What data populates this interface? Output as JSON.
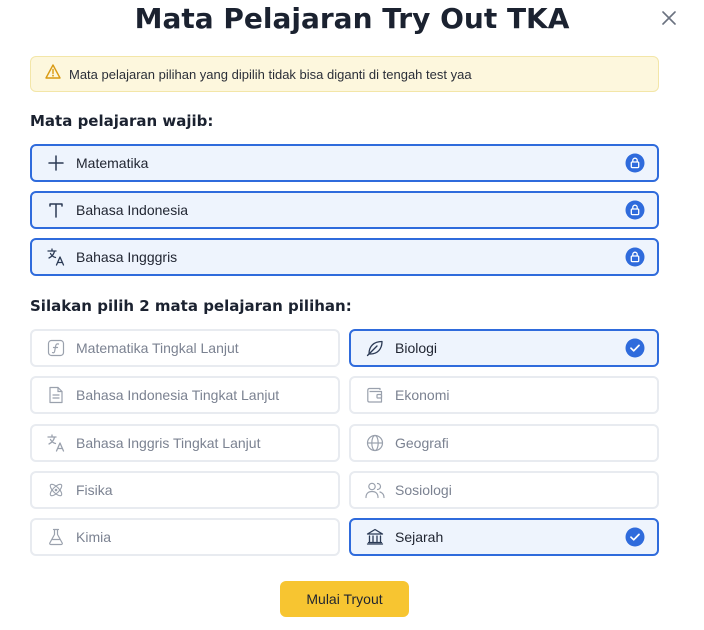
{
  "modal": {
    "title": "Mata Pelajaran Try Out TKA",
    "warning": "Mata pelajaran pilihan yang dipilih tidak bisa diganti di tengah test yaa"
  },
  "mandatory": {
    "label": "Mata pelajaran wajib:",
    "items": [
      {
        "label": "Matematika",
        "icon": "plus-icon"
      },
      {
        "label": "Bahasa Indonesia",
        "icon": "text-t-icon"
      },
      {
        "label": "Bahasa Ingggris",
        "icon": "translate-icon"
      }
    ]
  },
  "optional": {
    "label": "Silakan pilih 2 mata pelajaran pilihan:",
    "items": [
      {
        "label": "Matematika Tingkal Lanjut",
        "icon": "function-icon",
        "selected": false
      },
      {
        "label": "Biologi",
        "icon": "leaf-icon",
        "selected": true
      },
      {
        "label": "Bahasa Indonesia Tingkat Lanjut",
        "icon": "document-icon",
        "selected": false
      },
      {
        "label": "Ekonomi",
        "icon": "wallet-icon",
        "selected": false
      },
      {
        "label": "Bahasa Inggris Tingkat Lanjut",
        "icon": "translate-icon",
        "selected": false
      },
      {
        "label": "Geografi",
        "icon": "globe-icon",
        "selected": false
      },
      {
        "label": "Fisika",
        "icon": "atom-icon",
        "selected": false
      },
      {
        "label": "Sosiologi",
        "icon": "users-icon",
        "selected": false
      },
      {
        "label": "Kimia",
        "icon": "flask-icon",
        "selected": false
      },
      {
        "label": "Sejarah",
        "icon": "museum-icon",
        "selected": true
      }
    ]
  },
  "actions": {
    "start_label": "Mulai Tryout"
  },
  "colors": {
    "accent": "#2f6bdc",
    "warning_bg": "#fdf7dd",
    "button": "#f7c531"
  }
}
